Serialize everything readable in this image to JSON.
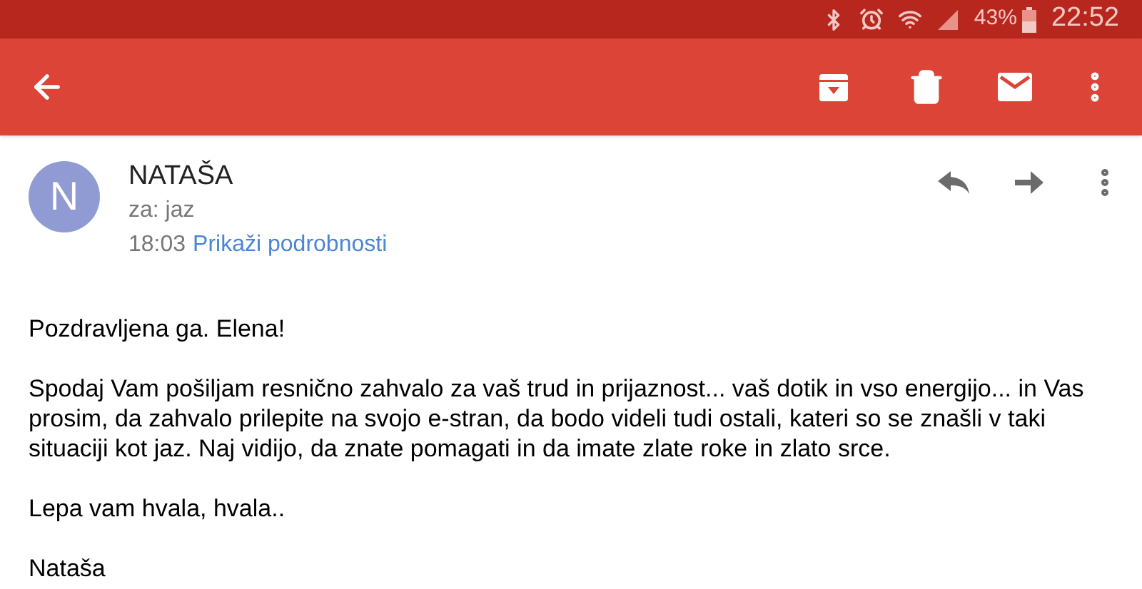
{
  "status_bar": {
    "battery": "43%",
    "time": "22:52"
  },
  "message": {
    "avatar_letter": "N",
    "sender": "NATAŠA",
    "recipient": "za: jaz",
    "time": "18:03",
    "details_link": "Prikaži podrobnosti"
  },
  "body": [
    "Pozdravljena ga. Elena!",
    "Spodaj Vam pošiljam resnično zahvalo za vaš trud in prijaznost... vaš dotik in vso energijo... in Vas prosim, da zahvalo prilepite na svojo e-stran, da bodo videli tudi ostali, kateri so se znašli v taki situaciji kot jaz. Naj vidijo, da znate pomagati in da imate zlate roke in zlato srce.",
    "Lepa vam hvala, hvala..",
    "Nataša"
  ]
}
